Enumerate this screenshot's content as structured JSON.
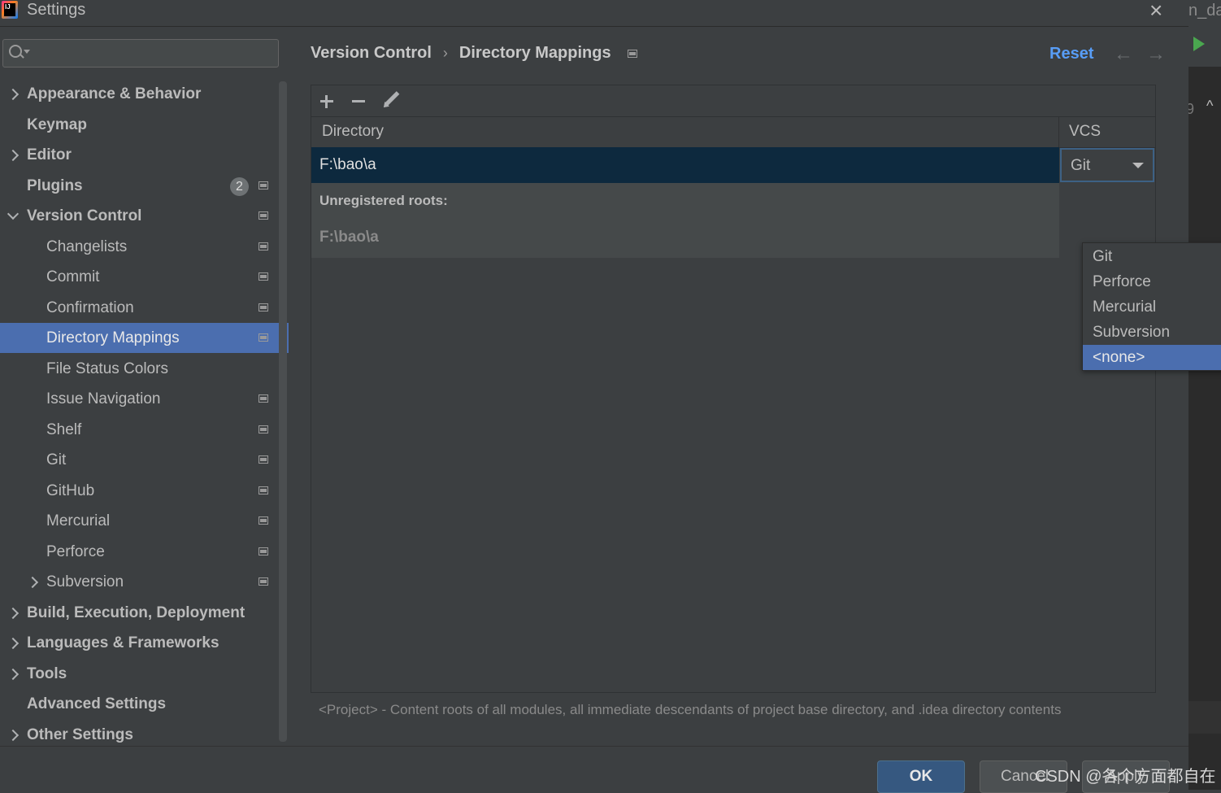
{
  "window": {
    "title": "Settings",
    "app_logo": "IJ",
    "close_icon": "×"
  },
  "background_app": {
    "tab_text": "n_dao",
    "line_number": "9"
  },
  "sidebar": {
    "search_placeholder": "",
    "items": [
      {
        "label": "Appearance & Behavior",
        "level": 0,
        "bold": true,
        "expander": "collapsed"
      },
      {
        "label": "Keymap",
        "level": 0,
        "bold": true,
        "expander": "none"
      },
      {
        "label": "Editor",
        "level": 0,
        "bold": true,
        "expander": "collapsed"
      },
      {
        "label": "Plugins",
        "level": 0,
        "bold": true,
        "expander": "none",
        "badge": "2",
        "project_icon": true
      },
      {
        "label": "Version Control",
        "level": 0,
        "bold": true,
        "expander": "expanded",
        "project_icon": true
      },
      {
        "label": "Changelists",
        "level": 1,
        "project_icon": true
      },
      {
        "label": "Commit",
        "level": 1,
        "project_icon": true
      },
      {
        "label": "Confirmation",
        "level": 1,
        "project_icon": true
      },
      {
        "label": "Directory Mappings",
        "level": 1,
        "project_icon": true,
        "selected": true
      },
      {
        "label": "File Status Colors",
        "level": 1
      },
      {
        "label": "Issue Navigation",
        "level": 1,
        "project_icon": true
      },
      {
        "label": "Shelf",
        "level": 1,
        "project_icon": true
      },
      {
        "label": "Git",
        "level": 1,
        "project_icon": true
      },
      {
        "label": "GitHub",
        "level": 1,
        "project_icon": true
      },
      {
        "label": "Mercurial",
        "level": 1,
        "project_icon": true
      },
      {
        "label": "Perforce",
        "level": 1,
        "project_icon": true
      },
      {
        "label": "Subversion",
        "level": 1,
        "project_icon": true,
        "expander": "collapsed"
      },
      {
        "label": "Build, Execution, Deployment",
        "level": 0,
        "bold": true,
        "expander": "collapsed"
      },
      {
        "label": "Languages & Frameworks",
        "level": 0,
        "bold": true,
        "expander": "collapsed"
      },
      {
        "label": "Tools",
        "level": 0,
        "bold": true,
        "expander": "collapsed"
      },
      {
        "label": "Advanced Settings",
        "level": 0,
        "bold": true,
        "expander": "none"
      },
      {
        "label": "Other Settings",
        "level": 0,
        "bold": true,
        "expander": "collapsed"
      }
    ],
    "help_label": "?"
  },
  "header": {
    "breadcrumb": [
      "Version Control",
      "Directory Mappings"
    ],
    "reset_label": "Reset",
    "back_icon": "←",
    "forward_icon": "→"
  },
  "table": {
    "columns": [
      "Directory",
      "VCS"
    ],
    "rows": [
      {
        "directory": "F:\\bao\\a",
        "vcs": "Git"
      }
    ],
    "unregistered_title": "Unregistered roots:",
    "unregistered_paths": [
      "F:\\bao\\a"
    ]
  },
  "vcs_dropdown": {
    "options": [
      "Git",
      "Perforce",
      "Mercurial",
      "Subversion",
      "<none>"
    ],
    "highlighted": "<none>"
  },
  "footnote": "<Project> - Content roots of all modules, all immediate descendants of project base directory, and .idea directory contents",
  "buttons": {
    "ok": "OK",
    "cancel": "Cancel",
    "apply": "Apply"
  },
  "watermark": "CSDN @各个方面都自在",
  "colors": {
    "selection": "#4b6eaf",
    "row_selection": "#0d293e",
    "link": "#589df6",
    "ok_button": "#365880"
  }
}
